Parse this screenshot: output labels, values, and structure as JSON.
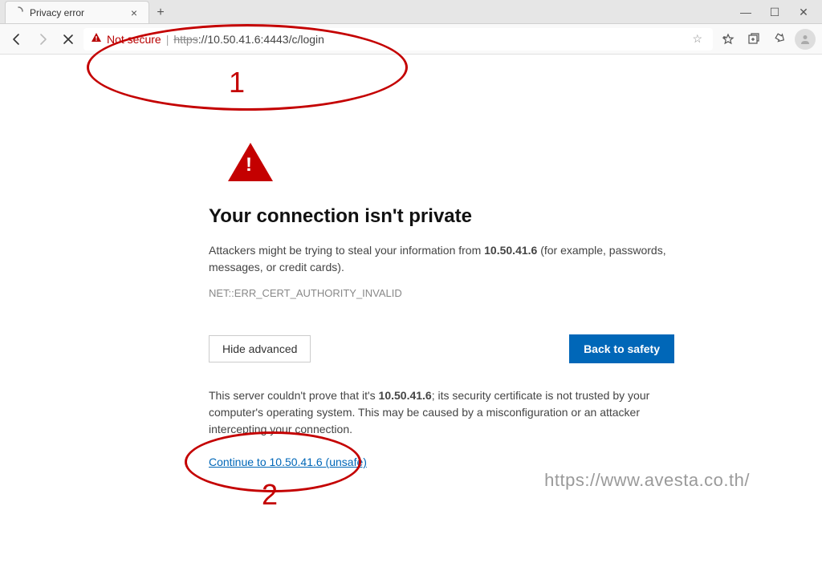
{
  "tab": {
    "title": "Privacy error"
  },
  "address": {
    "not_secure": "Not secure",
    "https_struck": "https",
    "rest": "://10.50.41.6:4443/c/login"
  },
  "page": {
    "title": "Your connection isn't private",
    "desc_pre": "Attackers might be trying to steal your information from ",
    "desc_bold": "10.50.41.6",
    "desc_post": " (for example, passwords, messages, or credit cards).",
    "error_code": "NET::ERR_CERT_AUTHORITY_INVALID",
    "hide_label": "Hide advanced",
    "safety_label": "Back to safety",
    "adv_pre": "This server couldn't prove that it's ",
    "adv_bold": "10.50.41.6",
    "adv_post": "; its security certificate is not trusted by your computer's operating system. This may be caused by a misconfiguration or an attacker intercepting your connection.",
    "continue_link": "Continue to 10.50.41.6 (unsafe)"
  },
  "annotations": {
    "label1": "1",
    "label2": "2"
  },
  "watermark": "https://www.avesta.co.th/"
}
